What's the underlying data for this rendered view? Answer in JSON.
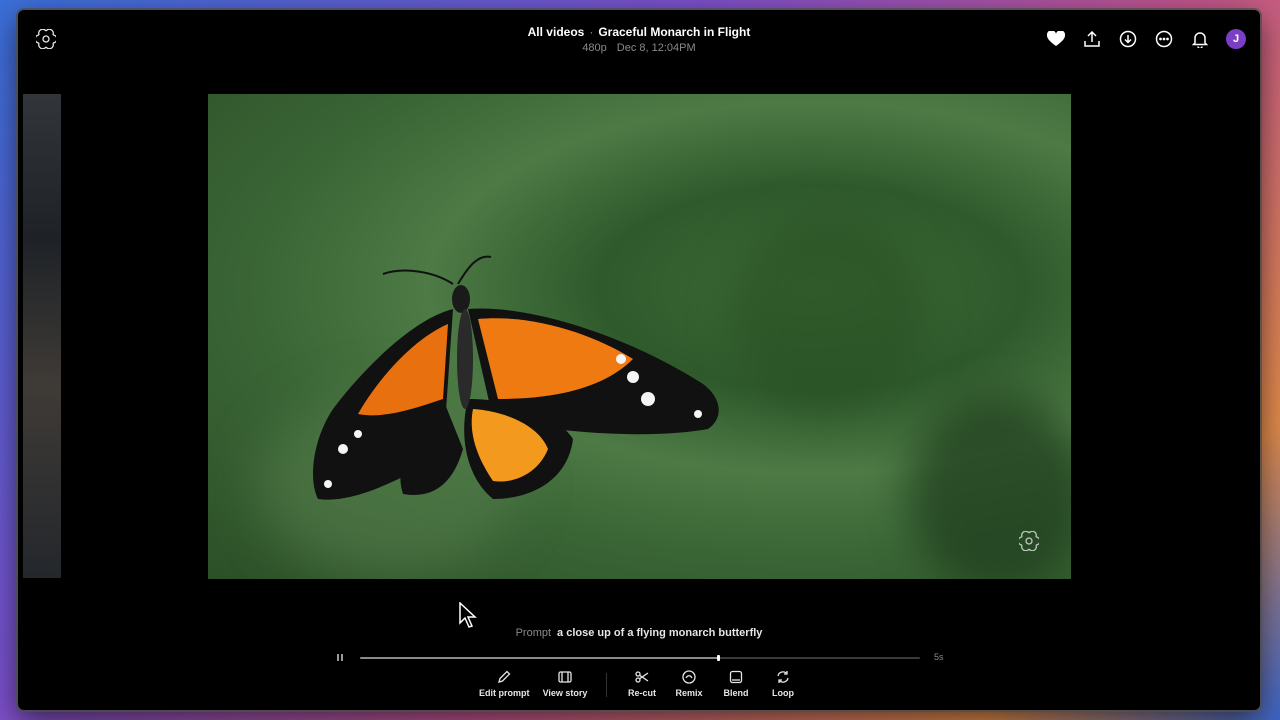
{
  "header": {
    "breadcrumb": "All videos",
    "separator": "·",
    "title": "Graceful Monarch in Flight",
    "resolution": "480p",
    "timestamp": "Dec 8, 12:04PM"
  },
  "actions": [
    {
      "name": "favorite-heart-icon"
    },
    {
      "name": "share-icon"
    },
    {
      "name": "download-icon"
    },
    {
      "name": "more-options-icon"
    },
    {
      "name": "notifications-bell-icon"
    }
  ],
  "user": {
    "avatar_letter": "J",
    "avatar_color": "#7a3fc4"
  },
  "prompt": {
    "label": "Prompt",
    "text": "a close up of a flying monarch butterfly"
  },
  "playback": {
    "duration": "5s",
    "progress": 0.64,
    "state": "playing"
  },
  "toolbar": {
    "edit_prompt": "Edit prompt",
    "view_story": "View story",
    "recut": "Re-cut",
    "remix": "Remix",
    "blend": "Blend",
    "loop": "Loop"
  },
  "colors": {
    "background": "#000000",
    "text": "#ffffff",
    "muted": "#8a8a8a"
  }
}
